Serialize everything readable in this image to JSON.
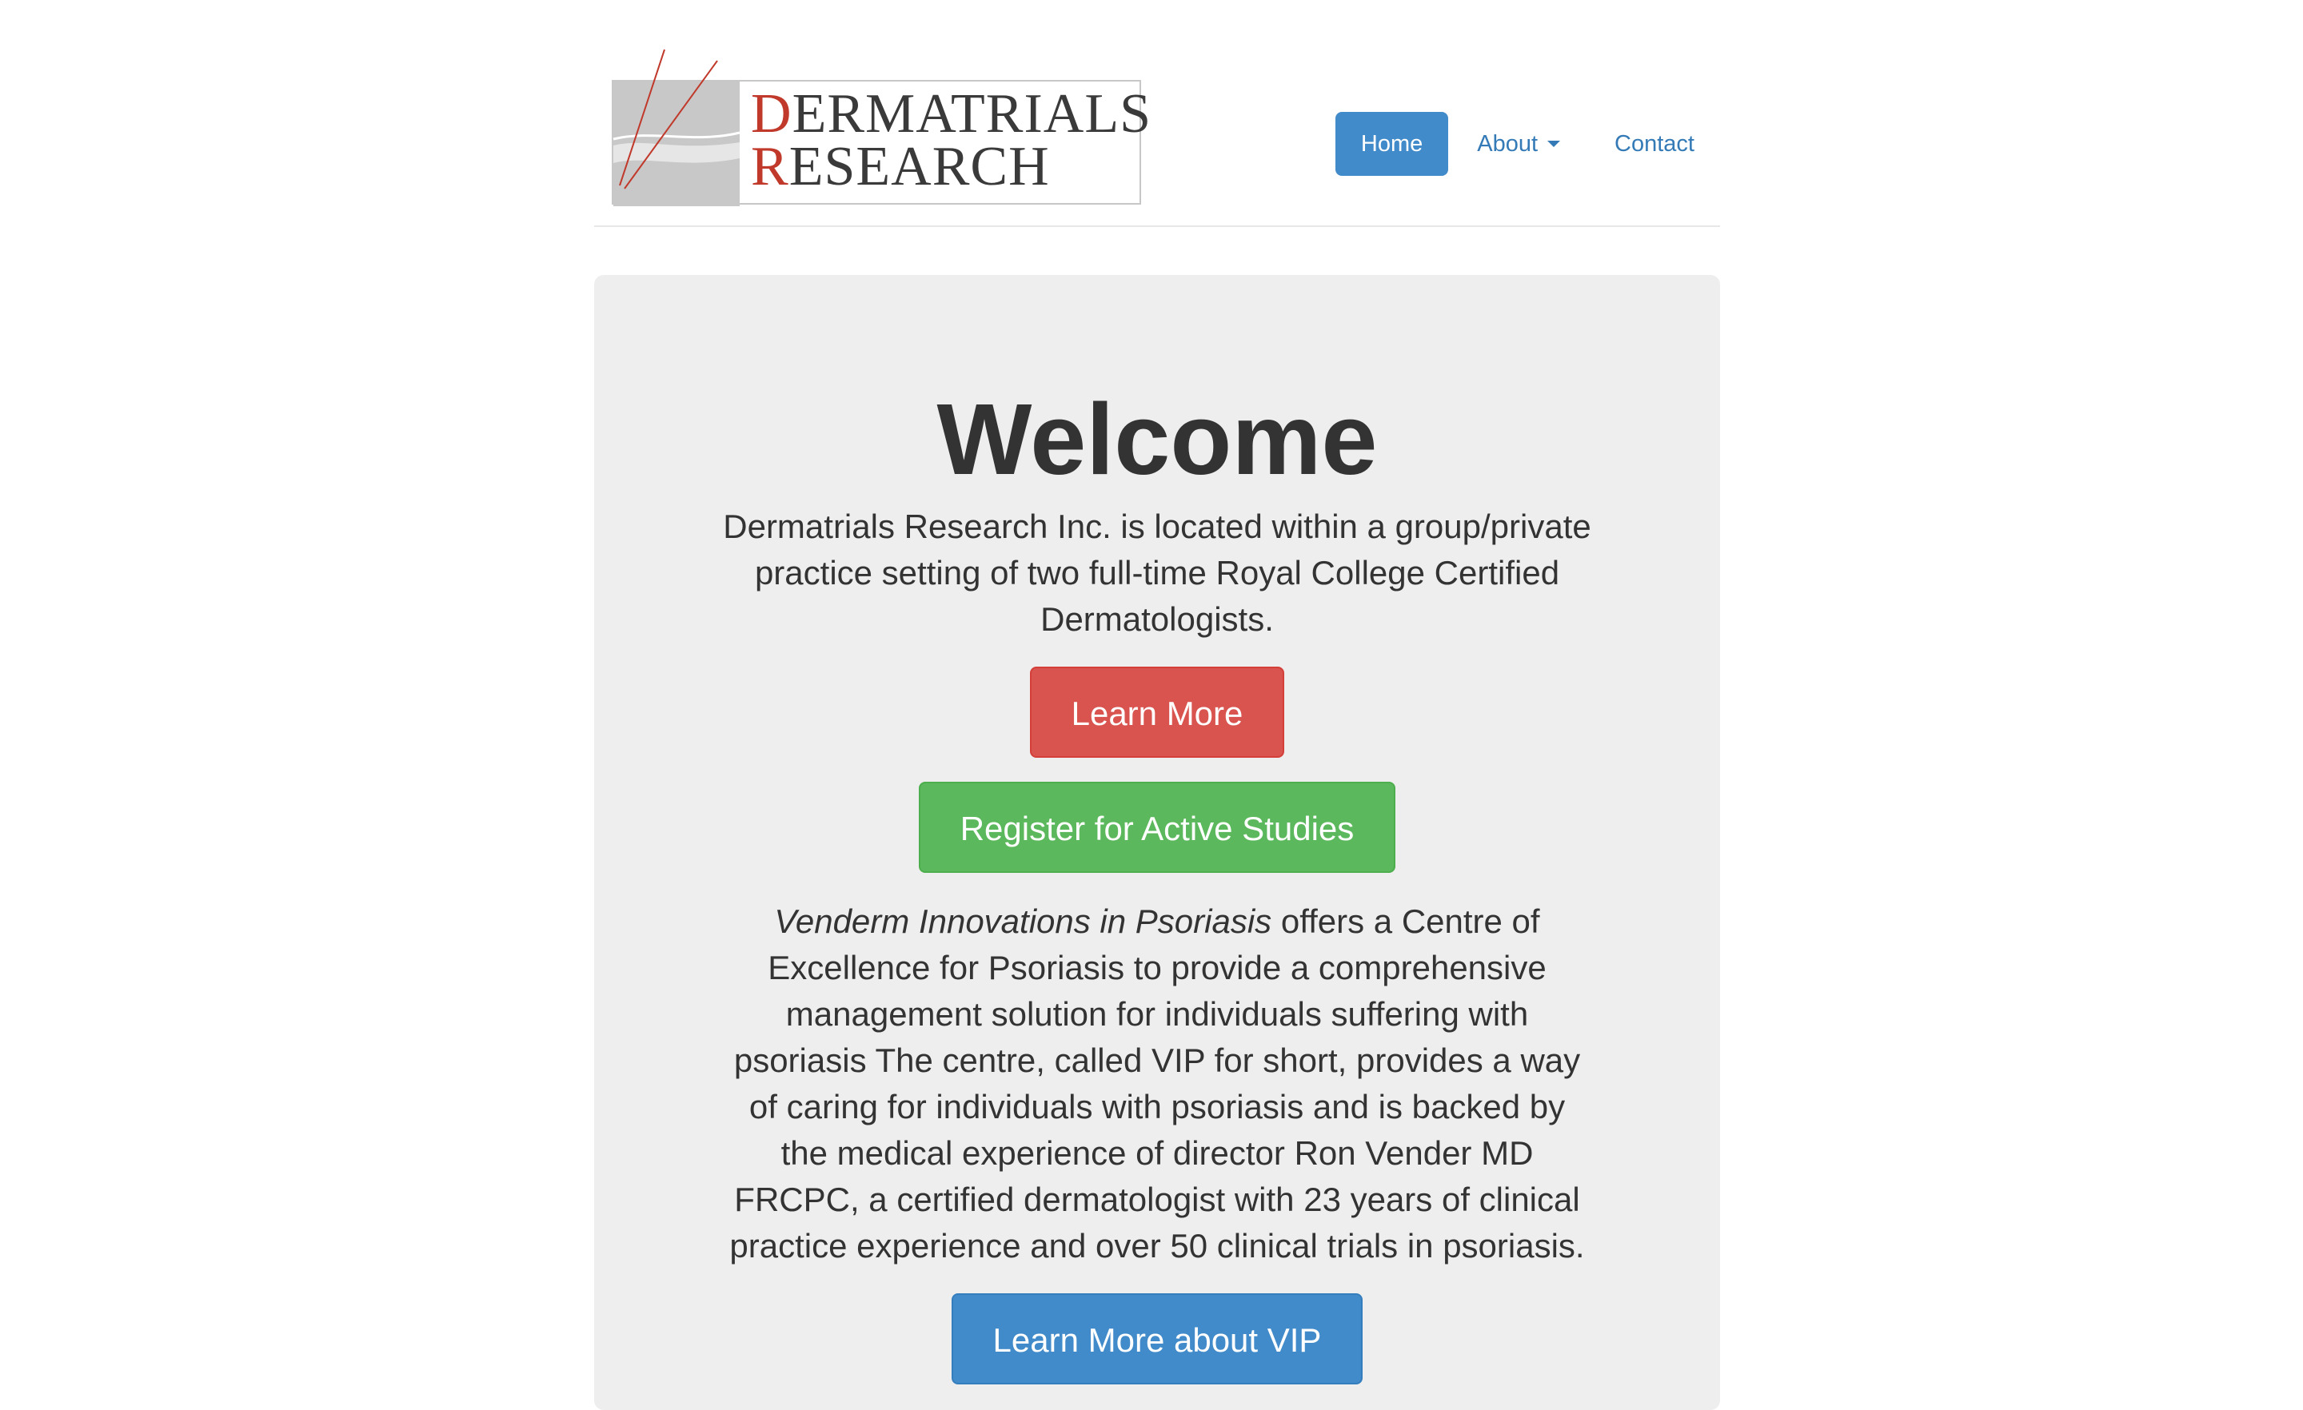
{
  "header": {
    "logo": {
      "line1_initial": "D",
      "line1_rest": "ERMATRIALS",
      "line2_initial": "R",
      "line2_rest": "ESEARCH",
      "accent_color": "#c0392b"
    },
    "nav": {
      "home": "Home",
      "about": "About",
      "contact": "Contact"
    }
  },
  "hero": {
    "title": "Welcome",
    "intro": "Dermatrials Research Inc. is located within a group/private practice setting of two full-time Royal College Certified Dermatologists.",
    "learn_more": "Learn More",
    "register": "Register for Active Studies",
    "vip_name": "Venderm Innovations in Psoriasis",
    "vip_text": " offers a Centre of Excellence for Psoriasis to provide a comprehensive management solution for individuals suffering with psoriasis The centre, called VIP for short, provides a way of caring for individuals with psoriasis and is backed by the medical experience of director Ron Vender MD FRCPC, a certified dermatologist with 23 years of clinical practice experience and over 50 clinical trials in psoriasis.",
    "learn_more_vip": "Learn More about VIP"
  },
  "colors": {
    "primary": "#428bca",
    "danger": "#d9534f",
    "success": "#5cb85c",
    "jumbotron_bg": "#eeeeee"
  }
}
